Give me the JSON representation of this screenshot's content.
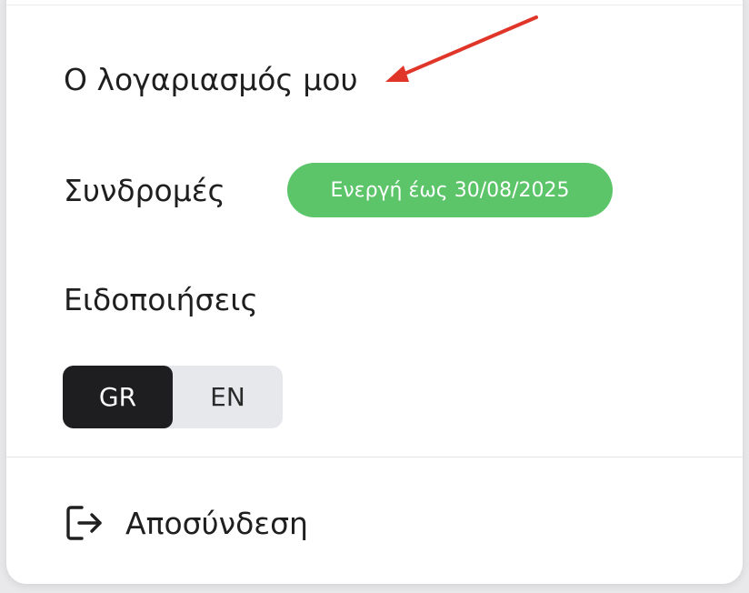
{
  "menu": {
    "account_label": "Ο λογαριασμός μου",
    "subscriptions_label": "Συνδρομές",
    "subscription_badge": "Ενεργή έως 30/08/2025",
    "notifications_label": "Ειδοποιήσεις",
    "language": {
      "options": [
        "GR",
        "EN"
      ],
      "selected": "GR"
    },
    "logout_label": "Αποσύνδεση"
  },
  "icons": {
    "logout": "logout-icon",
    "annotation": "red-arrow-icon"
  },
  "colors": {
    "badge_bg": "#5cc469",
    "toggle_active_bg": "#1e1e20",
    "toggle_bg": "#e7e8ec",
    "annotation_arrow": "#e0362a"
  }
}
